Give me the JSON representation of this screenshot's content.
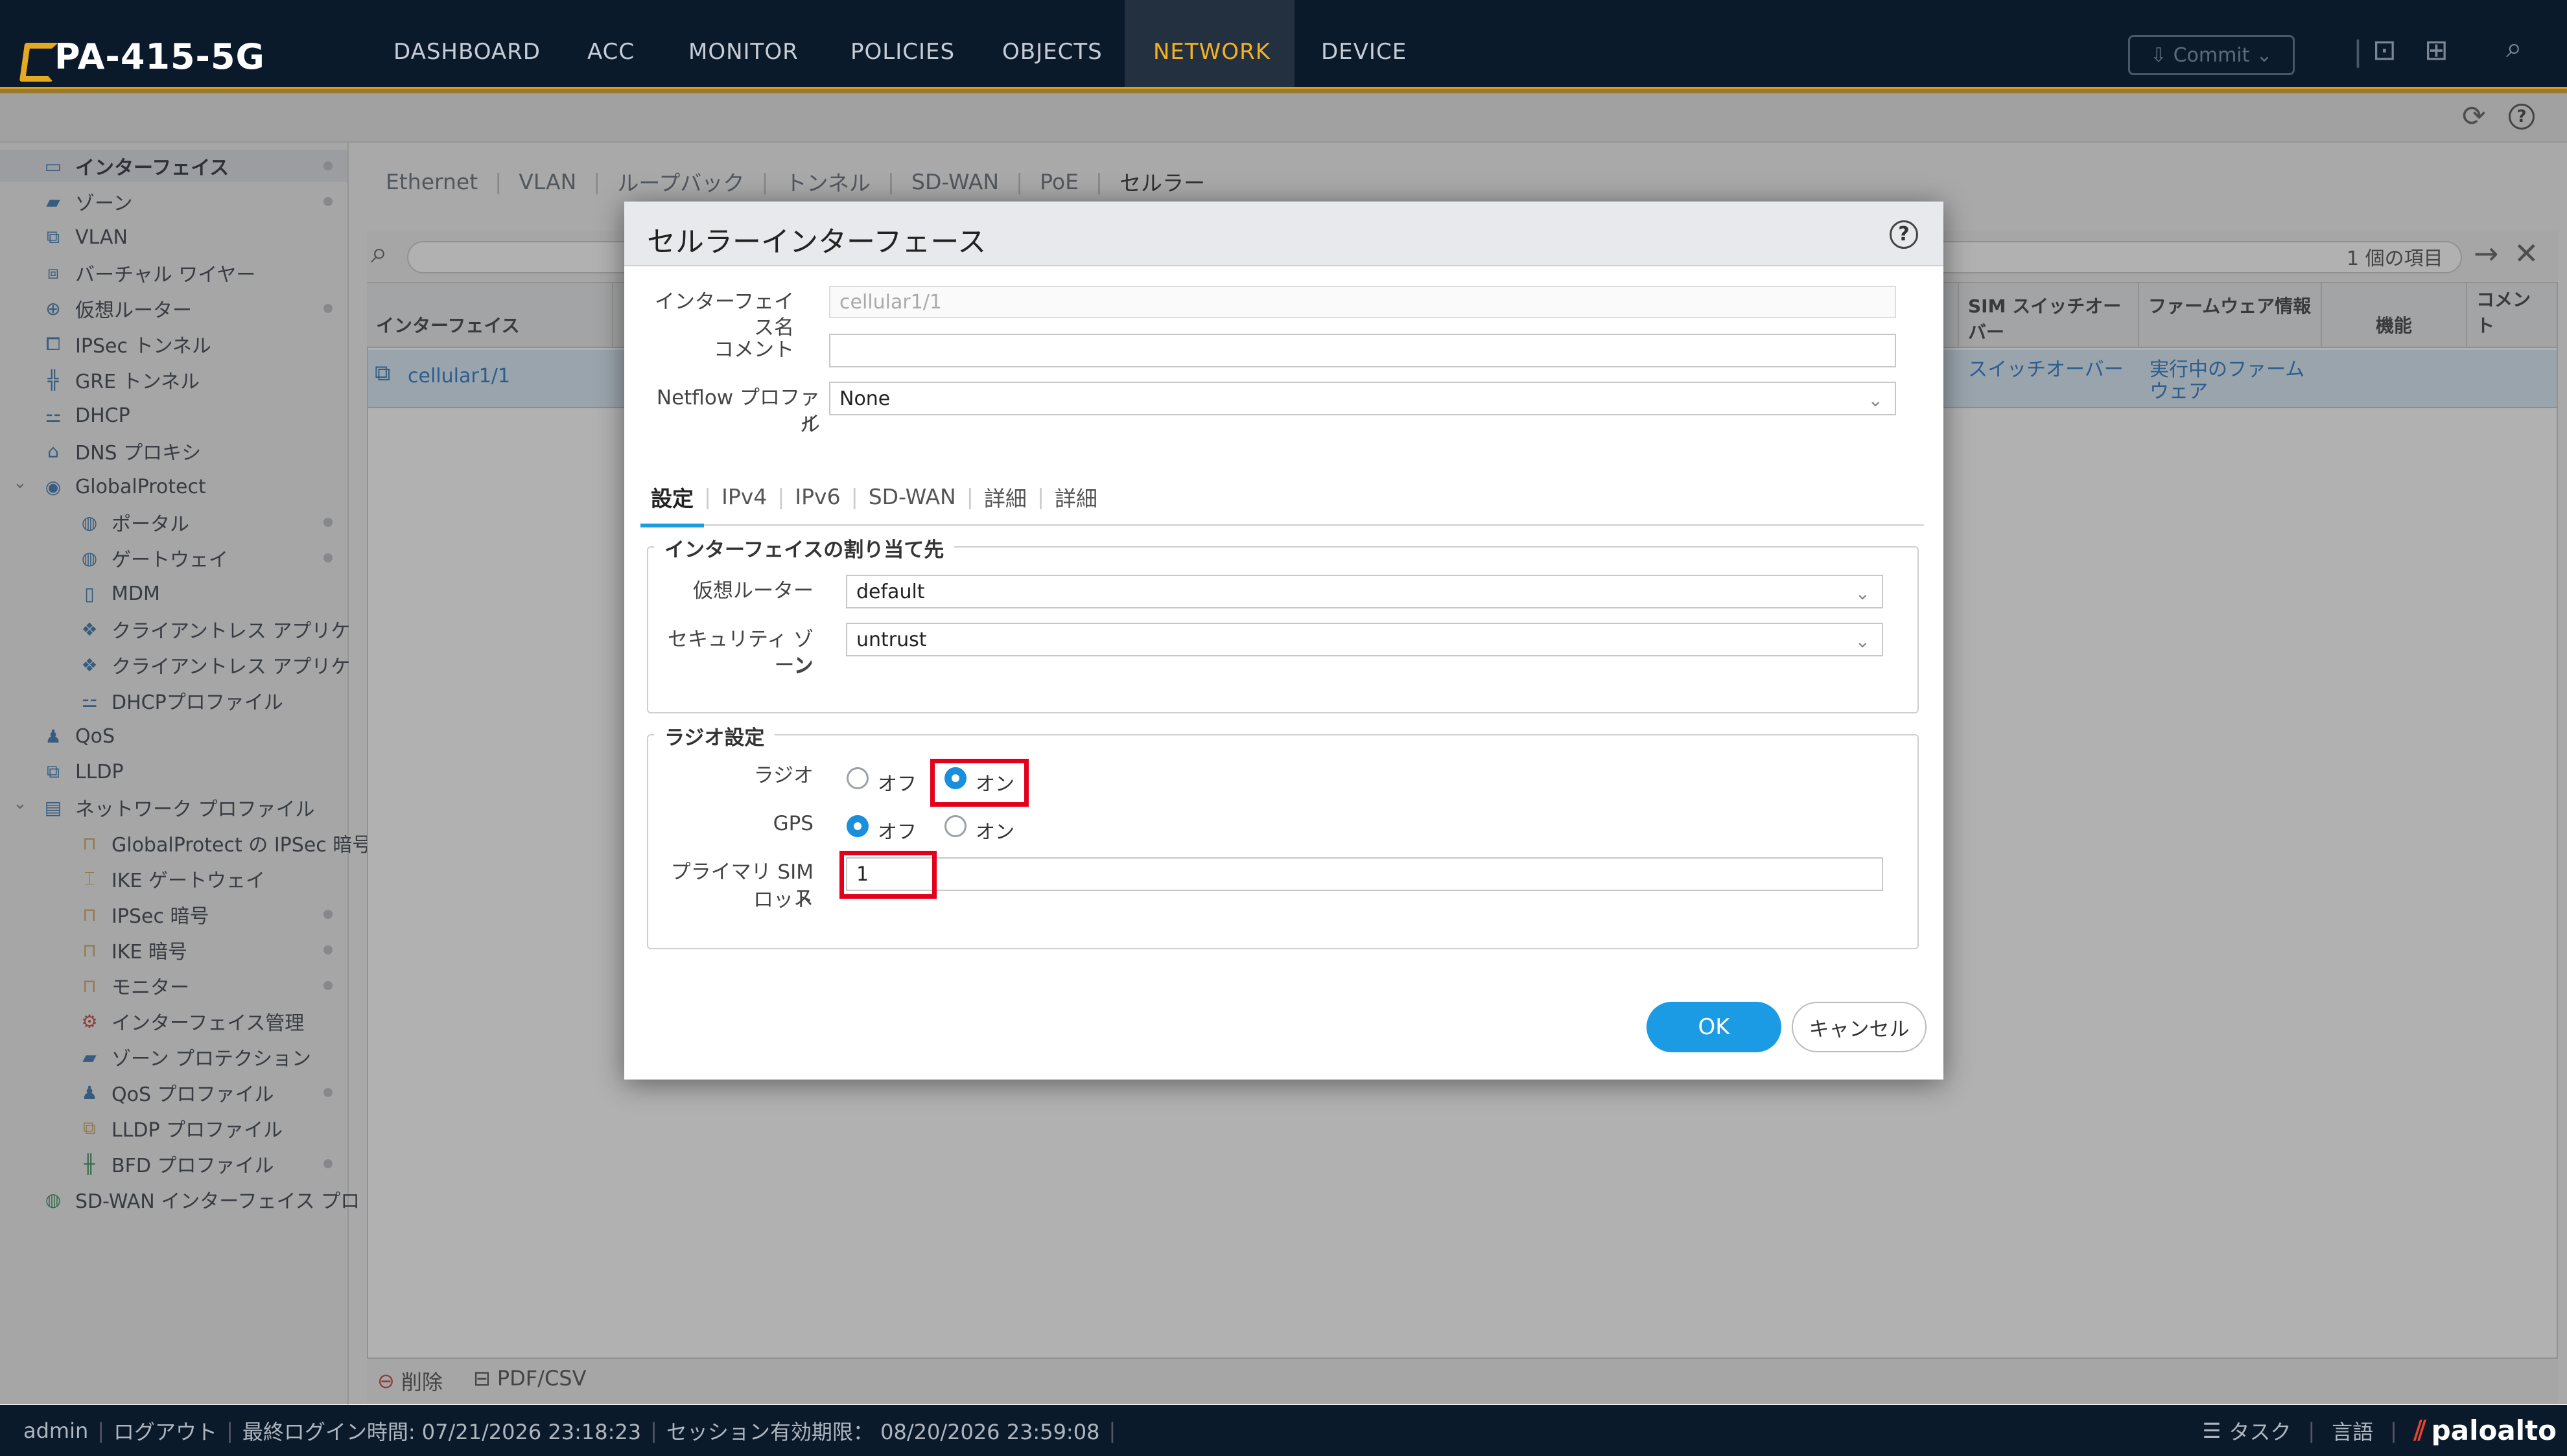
{
  "app": {
    "logo": "PA-415-5G",
    "nav": [
      "DASHBOARD",
      "ACC",
      "MONITOR",
      "POLICIES",
      "OBJECTS",
      "NETWORK",
      "DEVICE"
    ],
    "commit_label": "Commit"
  },
  "sidebar": {
    "items": [
      {
        "label": "インターフェイス",
        "icon": "interface-icon"
      },
      {
        "label": "ゾーン",
        "icon": "zone-icon"
      },
      {
        "label": "VLAN",
        "icon": "vlan-icon"
      },
      {
        "label": "バーチャル ワイヤー",
        "icon": "virtual-wire-icon"
      },
      {
        "label": "仮想ルーター",
        "icon": "virtual-router-icon"
      },
      {
        "label": "IPSec トンネル",
        "icon": "ipsec-tunnel-icon"
      },
      {
        "label": "GRE トンネル",
        "icon": "gre-tunnel-icon"
      },
      {
        "label": "DHCP",
        "icon": "dhcp-icon"
      },
      {
        "label": "DNS プロキシ",
        "icon": "dns-proxy-icon"
      },
      {
        "label": "GlobalProtect",
        "icon": "globalprotect-icon"
      },
      {
        "label": "ポータル",
        "icon": "portal-icon"
      },
      {
        "label": "ゲートウェイ",
        "icon": "gateway-icon"
      },
      {
        "label": "MDM",
        "icon": "mdm-icon"
      },
      {
        "label": "クライアントレス アプリケ",
        "icon": "clientless-app-icon"
      },
      {
        "label": "クライアントレス アプリケ",
        "icon": "clientless-app-group-icon"
      },
      {
        "label": "DHCPプロファイル",
        "icon": "dhcp-profile-icon"
      },
      {
        "label": "QoS",
        "icon": "qos-icon"
      },
      {
        "label": "LLDP",
        "icon": "lldp-icon"
      },
      {
        "label": "ネットワーク プロファイル",
        "icon": "network-profile-icon"
      },
      {
        "label": "GlobalProtect の IPSec 暗号",
        "icon": "lock-icon"
      },
      {
        "label": "IKE ゲートウェイ",
        "icon": "ike-gateway-icon"
      },
      {
        "label": "IPSec 暗号",
        "icon": "lock-icon"
      },
      {
        "label": "IKE 暗号",
        "icon": "lock-icon"
      },
      {
        "label": "モニター",
        "icon": "monitor-icon"
      },
      {
        "label": "インターフェイス管理",
        "icon": "interface-mgmt-icon"
      },
      {
        "label": "ゾーン プロテクション",
        "icon": "zone-protection-icon"
      },
      {
        "label": "QoS プロファイル",
        "icon": "qos-profile-icon"
      },
      {
        "label": "LLDP プロファイル",
        "icon": "lldp-profile-icon"
      },
      {
        "label": "BFD プロファイル",
        "icon": "bfd-profile-icon"
      },
      {
        "label": "SD-WAN インターフェイス プロ",
        "icon": "sdwan-interface-icon"
      }
    ]
  },
  "main": {
    "tabs": [
      "Ethernet",
      "VLAN",
      "ループバック",
      "トンネル",
      "SD-WAN",
      "PoE",
      "セルラー"
    ],
    "item_count": "1 個の項目",
    "columns": [
      "インターフェイス",
      "SIM スイッチオーバー",
      "ファームウェア情報",
      "機能",
      "コメント"
    ],
    "row": {
      "interface": "cellular1/1",
      "sim_switchover": "スイッチオーバー",
      "firmware": "実行中のファームウェア"
    },
    "footer": {
      "delete": "削除",
      "pdfcsv": "PDF/CSV"
    }
  },
  "dialog": {
    "title": "セルラーインターフェース",
    "fields": {
      "interface_name_label": "インターフェイス名",
      "interface_name_value": "cellular1/1",
      "comment_label": "コメント",
      "comment_value": "",
      "netflow_label_1": "Netflow プロファイ",
      "netflow_label_2": "ル",
      "netflow_value": "None"
    },
    "tabs": [
      "設定",
      "IPv4",
      "IPv6",
      "SD-WAN",
      "詳細",
      "詳細"
    ],
    "assignment": {
      "title": "インターフェイスの割り当て先",
      "vr_label": "仮想ルーター",
      "vr_value": "default",
      "zone_label_1": "セキュリティ ゾーン",
      "zone_label_2": "ン",
      "zone_value": "untrust"
    },
    "radio": {
      "title": "ラジオ設定",
      "radio_label": "ラジオ",
      "gps_label": "GPS",
      "off": "オフ",
      "on": "オン",
      "radio_selected": "オン",
      "gps_selected": "オフ",
      "sim_label_1": "プライマリ SIM ス",
      "sim_label_2": "ロット",
      "sim_value": "1"
    },
    "ok": "OK",
    "cancel": "キャンセル"
  },
  "status": {
    "user": "admin",
    "logout": "ログアウト",
    "last_login": "最終ログイン時間: 07/21/2026 23:18:23",
    "session": "セッション有効期限： 08/20/2026 23:59:08",
    "tasks": "タスク",
    "language": "言語",
    "brand": "paloalto"
  }
}
